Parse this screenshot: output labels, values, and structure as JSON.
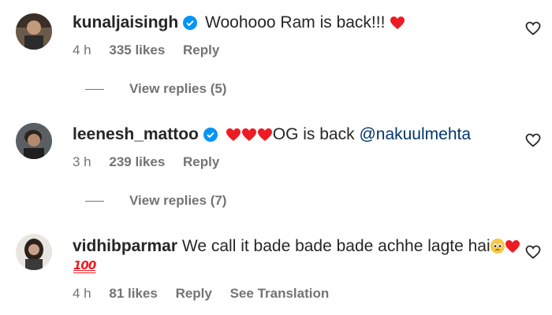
{
  "comments": [
    {
      "username": "kunaljaisingh",
      "verified": true,
      "text": "Woohooo Ram is back!!!",
      "time": "4 h",
      "likes": "335 likes",
      "reply": "Reply",
      "view_replies": "View replies (5)"
    },
    {
      "username": "leenesh_mattoo",
      "verified": true,
      "text": "OG is back",
      "mention": "@nakuulmehta",
      "time": "3 h",
      "likes": "239 likes",
      "reply": "Reply",
      "view_replies": "View replies (7)"
    },
    {
      "username": "vidhibparmar",
      "verified": false,
      "text": "We call it bade bade bade achhe lagte hai",
      "hundred": "100",
      "time": "4 h",
      "likes": "81 likes",
      "reply": "Reply",
      "see_translation": "See Translation"
    }
  ],
  "colors": {
    "text": "#262626",
    "muted": "#737373",
    "verified": "#0095f6",
    "heart": "#ed1c24",
    "mention": "#00376b"
  }
}
